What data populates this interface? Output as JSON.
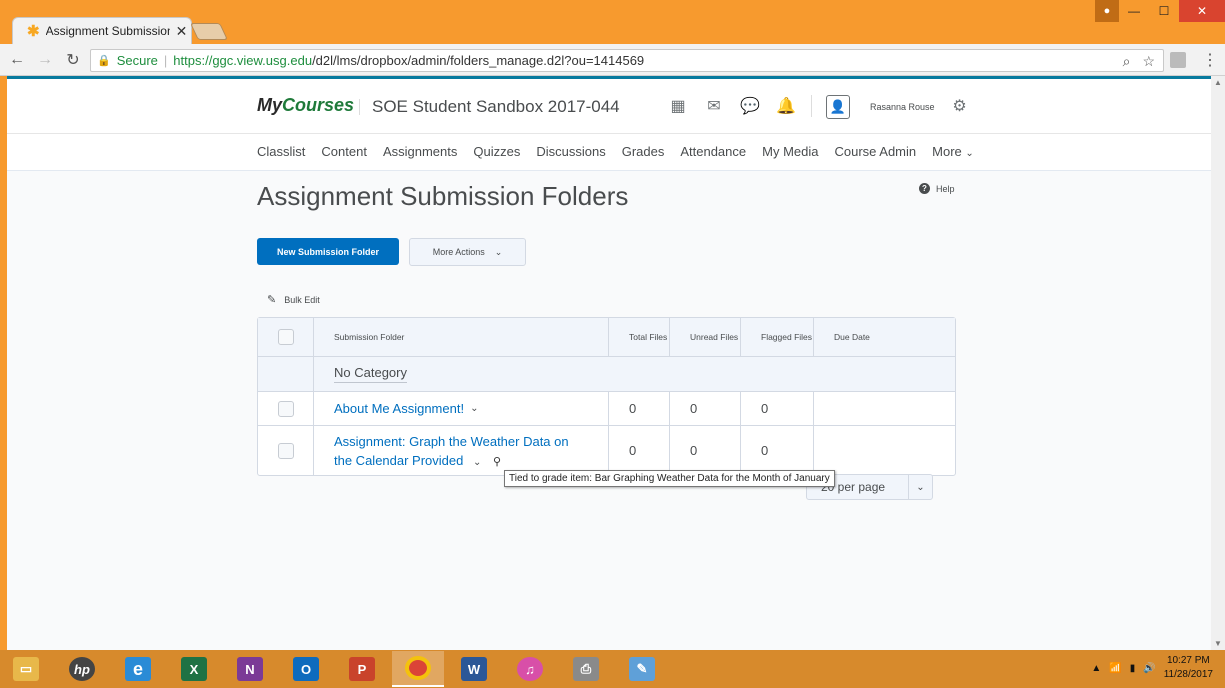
{
  "browser": {
    "tab_title": "Assignment Submission F",
    "tab_close": "✕",
    "secure_label": "Secure",
    "url_host": "https://ggc.view.usg.edu",
    "url_path": "/d2l/lms/dropbox/admin/folders_manage.d2l?ou=1414569"
  },
  "header": {
    "logo_my": "My",
    "logo_courses": "Courses",
    "course_title": "SOE Student Sandbox 2017-044",
    "username": "Rasanna Rouse"
  },
  "nav": {
    "items": [
      "Classlist",
      "Content",
      "Assignments",
      "Quizzes",
      "Discussions",
      "Grades",
      "Attendance",
      "My Media",
      "Course Admin",
      "More"
    ]
  },
  "page": {
    "title": "Assignment Submission Folders",
    "help": "Help",
    "new_button": "New Submission Folder",
    "more_actions": "More Actions",
    "bulk_edit": "Bulk Edit"
  },
  "table": {
    "headers": {
      "folder": "Submission Folder",
      "total": "Total Files",
      "unread": "Unread Files",
      "flagged": "Flagged Files",
      "due": "Due Date"
    },
    "category": "No Category",
    "rows": [
      {
        "name": "About Me Assignment!",
        "total": "0",
        "unread": "0",
        "flagged": "0",
        "due": ""
      },
      {
        "name": "Assignment: Graph the Weather Data on the Calendar Provided",
        "total": "0",
        "unread": "0",
        "flagged": "0",
        "due": ""
      }
    ]
  },
  "pagination": {
    "per_page_label": "20 per page"
  },
  "tooltip": "Tied to grade item: Bar Graphing Weather Data for the Month of January",
  "taskbar": {
    "time": "10:27 PM",
    "date": "11/28/2017"
  },
  "colors": {
    "accent": "#006fbf",
    "window_frame": "#f79a2e",
    "logo_green": "#1f7a3a"
  }
}
